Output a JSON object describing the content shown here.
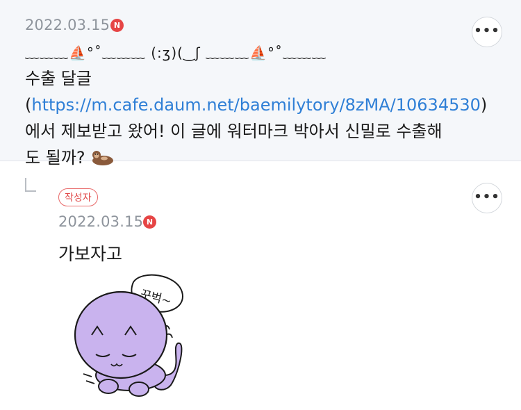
{
  "top_comment": {
    "date": "2022.03.15",
    "new_badge": "N",
    "more_label": "•••",
    "deco_line": "﹏﹏﹏⛵°˚﹏﹏﹏ (:ʒ)(‿ʃ ﹏﹏﹏⛵°˚﹏﹏﹏",
    "text_before_link": "수출 달글 (",
    "link": "https://m.cafe.daum.net/baemilytory/8zMA/10634530",
    "text_after_link": ") 에서 제보받고 왔어! 이 글에 워터마크 박아서 신밀로 수출해도 될까?",
    "emoji_icon": "otter-icon"
  },
  "reply": {
    "author_badge": "작성자",
    "date": "2022.03.15",
    "new_badge": "N",
    "more_label": "•••",
    "text": "가보자고",
    "sticker_text": "꾸벅~",
    "sticker_icon": "bowing-cat-sticker"
  },
  "colors": {
    "top_bg": "#f5f7fa",
    "link": "#2f7fd6",
    "badge_red": "#e64545",
    "sticker_purple": "#c9b3ee"
  }
}
